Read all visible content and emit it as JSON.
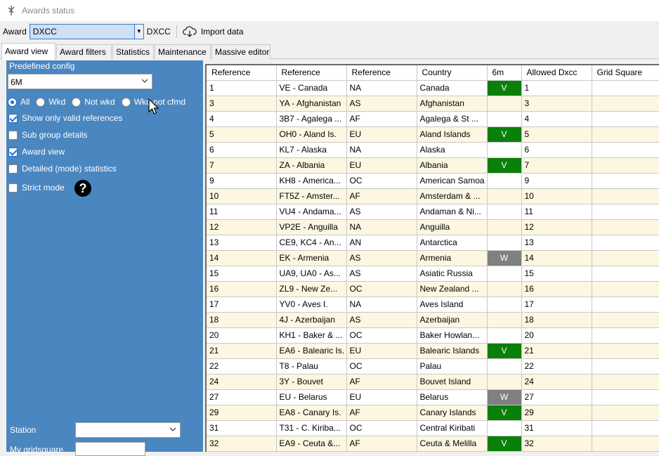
{
  "window": {
    "title": "Awards status"
  },
  "toolbar": {
    "award_label": "Award",
    "award_value": "DXCC",
    "award_suffix": "DXCC",
    "import_label": "Import data"
  },
  "tabs": [
    {
      "label": "Award view",
      "active": true
    },
    {
      "label": "Award filters"
    },
    {
      "label": "Statistics"
    },
    {
      "label": "Maintenance"
    },
    {
      "label": "Massive editor"
    }
  ],
  "panel": {
    "predefined_label": "Predefined config",
    "predefined_value": "6M",
    "radios": [
      {
        "label": "All",
        "checked": true
      },
      {
        "label": "Wkd",
        "checked": false
      },
      {
        "label": "Not wkd",
        "checked": false
      },
      {
        "label": "Wkd not cfmd",
        "checked": false
      }
    ],
    "checks": [
      {
        "label": "Show only valid references",
        "checked": true
      },
      {
        "label": "Sub group details",
        "checked": false
      },
      {
        "label": "Award view",
        "checked": true
      },
      {
        "label": "Detailed (mode) statistics",
        "checked": false
      },
      {
        "label": "Strict mode",
        "checked": false
      }
    ],
    "help_glyph": "?",
    "station_label": "Station",
    "gridsquare_label": "My gridsquare"
  },
  "table": {
    "columns": [
      "Reference",
      "Reference",
      "Reference",
      "Country",
      "6m",
      "Allowed Dxcc",
      "Grid Square"
    ],
    "rows": [
      [
        "1",
        "VE - Canada",
        "NA",
        "Canada",
        "V",
        "1",
        ""
      ],
      [
        "3",
        "YA - Afghanistan",
        "AS",
        "Afghanistan",
        "",
        "3",
        ""
      ],
      [
        "4",
        "3B7 - Agalega ...",
        "AF",
        "Agalega & St ...",
        "",
        "4",
        ""
      ],
      [
        "5",
        "OH0 - Aland Is.",
        "EU",
        "Aland Islands",
        "V",
        "5",
        ""
      ],
      [
        "6",
        "KL7 - Alaska",
        "NA",
        "Alaska",
        "",
        "6",
        ""
      ],
      [
        "7",
        "ZA - Albania",
        "EU",
        "Albania",
        "V",
        "7",
        ""
      ],
      [
        "9",
        "KH8 - America...",
        "OC",
        "American Samoa",
        "",
        "9",
        ""
      ],
      [
        "10",
        "FT5Z - Amster...",
        "AF",
        "Amsterdam & ...",
        "",
        "10",
        ""
      ],
      [
        "11",
        "VU4 - Andama...",
        "AS",
        "Andaman & Ni...",
        "",
        "11",
        ""
      ],
      [
        "12",
        "VP2E - Anguilla",
        "NA",
        "Anguilla",
        "",
        "12",
        ""
      ],
      [
        "13",
        "CE9, KC4 - An...",
        "AN",
        "Antarctica",
        "",
        "13",
        ""
      ],
      [
        "14",
        "EK - Armenia",
        "AS",
        "Armenia",
        "W",
        "14",
        ""
      ],
      [
        "15",
        "UA9, UA0 - As...",
        "AS",
        "Asiatic Russia",
        "",
        "15",
        ""
      ],
      [
        "16",
        "ZL9 - New Ze...",
        "OC",
        "New Zealand ...",
        "",
        "16",
        ""
      ],
      [
        "17",
        "YV0 - Aves I.",
        "NA",
        "Aves Island",
        "",
        "17",
        ""
      ],
      [
        "18",
        "4J - Azerbaijan",
        "AS",
        "Azerbaijan",
        "",
        "18",
        ""
      ],
      [
        "20",
        "KH1 - Baker & ...",
        "OC",
        "Baker Howlan...",
        "",
        "20",
        ""
      ],
      [
        "21",
        "EA6 - Balearic Is.",
        "EU",
        "Balearic Islands",
        "V",
        "21",
        ""
      ],
      [
        "22",
        "T8 - Palau",
        "OC",
        "Palau",
        "",
        "22",
        ""
      ],
      [
        "24",
        "3Y - Bouvet",
        "AF",
        "Bouvet Island",
        "",
        "24",
        ""
      ],
      [
        "27",
        "EU - Belarus",
        "EU",
        "Belarus",
        "W",
        "27",
        ""
      ],
      [
        "29",
        "EA8 - Canary Is.",
        "AF",
        "Canary Islands",
        "V",
        "29",
        ""
      ],
      [
        "31",
        "T31 - C. Kiriba...",
        "OC",
        "Central Kiribati",
        "",
        "31",
        ""
      ],
      [
        "32",
        "EA9 - Ceuta &...",
        "AF",
        "Ceuta & Melilla",
        "V",
        "32",
        ""
      ]
    ]
  },
  "colors": {
    "panel": "#4a86c0",
    "confirmed": "#0a800a",
    "worked": "#808080",
    "alt_row": "#fdf7e2"
  }
}
